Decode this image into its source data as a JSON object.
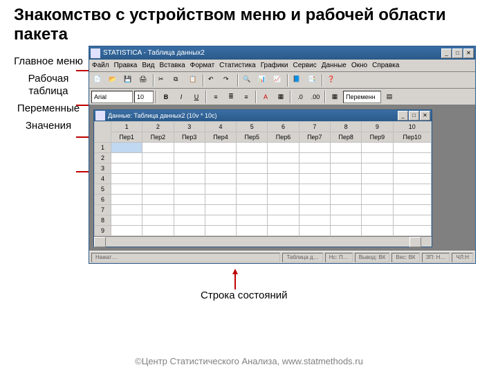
{
  "title": "Знакомство с устройством меню и рабочей области пакета",
  "labels": {
    "main_menu": "Главное меню",
    "worksheet": "Рабочая таблица",
    "variables": "Переменные",
    "values": "Значения",
    "statusbar": "Строка состояний"
  },
  "app": {
    "title": "STATISTICA - Таблица данных2",
    "menu": [
      "Файл",
      "Правка",
      "Вид",
      "Вставка",
      "Формат",
      "Статистика",
      "Графики",
      "Сервис",
      "Данные",
      "Окно",
      "Справка"
    ],
    "toolbar2": {
      "font": "Arial",
      "size": "10",
      "extra": "Переменн"
    },
    "doc_title": "Данные: Таблица данных2 (10v * 10c)",
    "columns": [
      "Пер1",
      "Пер2",
      "Пер3",
      "Пер4",
      "Пер5",
      "Пер6",
      "Пер7",
      "Пер8",
      "Пер9",
      "Пер10"
    ],
    "colnums": [
      "1",
      "2",
      "3",
      "4",
      "5",
      "6",
      "7",
      "8",
      "9",
      "10"
    ],
    "rows": [
      "1",
      "2",
      "3",
      "4",
      "5",
      "6",
      "7",
      "8",
      "9"
    ],
    "status": {
      "left": "Нажат…",
      "c1": "Таблица д…",
      "c2": "Нс: П…",
      "c3": "Вывод: ВК",
      "c4": "Вес: ВК",
      "c5": "ЗП: Н…",
      "c6": "ЧЛ:Н"
    }
  },
  "footer": "©Центр Статистического Анализа,\nwww.statmethods.ru"
}
